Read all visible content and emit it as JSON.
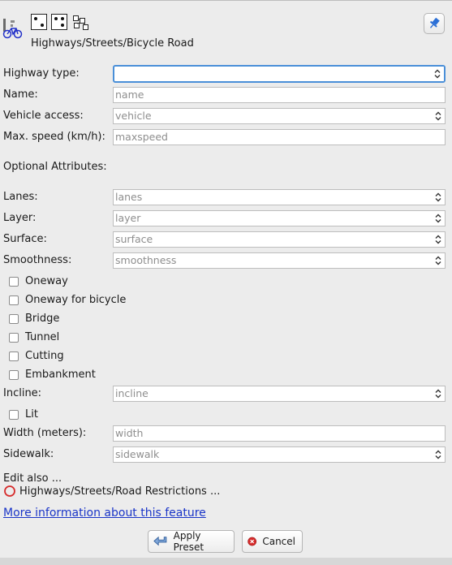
{
  "header": {
    "title": "Highways/Streets/Bicycle Road",
    "icons": [
      "bicycle-road-icon",
      "node-type-icon",
      "way-type-icon",
      "relation-type-icon",
      "pin-icon"
    ]
  },
  "fields": {
    "highway_type": {
      "label": "Highway type:",
      "value": ""
    },
    "name": {
      "label": "Name:",
      "placeholder": "name"
    },
    "vehicle": {
      "label": "Vehicle access:",
      "placeholder": "vehicle"
    },
    "maxspeed": {
      "label": "Max. speed (km/h):",
      "placeholder": "maxspeed"
    }
  },
  "optional": {
    "heading": "Optional Attributes:",
    "lanes": {
      "label": "Lanes:",
      "placeholder": "lanes"
    },
    "layer": {
      "label": "Layer:",
      "placeholder": "layer"
    },
    "surface": {
      "label": "Surface:",
      "placeholder": "surface"
    },
    "smoothness": {
      "label": "Smoothness:",
      "placeholder": "smoothness"
    },
    "checks": [
      "Oneway",
      "Oneway for bicycle",
      "Bridge",
      "Tunnel",
      "Cutting",
      "Embankment"
    ],
    "incline": {
      "label": "Incline:",
      "placeholder": "incline"
    },
    "lit": "Lit",
    "width": {
      "label": "Width (meters):",
      "placeholder": "width"
    },
    "sidewalk": {
      "label": "Sidewalk:",
      "placeholder": "sidewalk"
    }
  },
  "edit_also": {
    "heading": "Edit also ...",
    "item": "Highways/Streets/Road Restrictions ...",
    "item_icon": "circle-icon"
  },
  "more_info_link": "More information about this feature",
  "buttons": {
    "apply": "Apply Preset",
    "cancel": "Cancel"
  },
  "colors": {
    "focus": "#4a8fd8",
    "link": "#1a35c8",
    "cancel_red": "#d62b2b",
    "accent_blue": "#2b6fd6"
  }
}
